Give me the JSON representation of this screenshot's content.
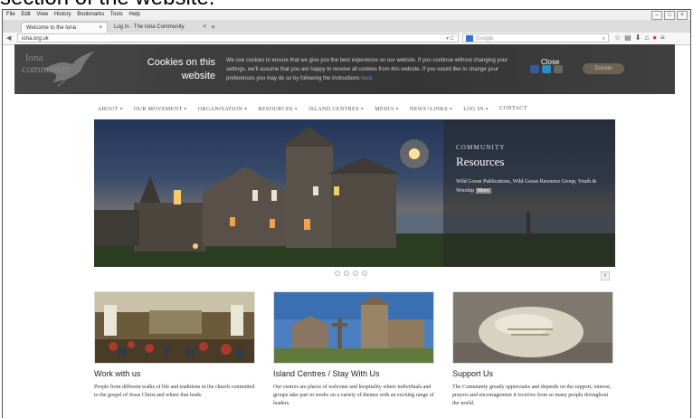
{
  "caption": "section of the website.",
  "browser": {
    "menu": [
      "File",
      "Edit",
      "View",
      "History",
      "Bookmarks",
      "Tools",
      "Help"
    ],
    "tabs": [
      {
        "label": "Welcome to the Iona Commun...",
        "close": "×"
      },
      {
        "label": "Log In · The Iona Community",
        "close": "×"
      }
    ],
    "new_tab": "+",
    "url": "iona.org.uk",
    "search_placeholder": "Google",
    "icons": [
      "back-icon",
      "reload-icon",
      "search-icon",
      "star-icon",
      "bookmarks-icon",
      "download-icon",
      "home-icon",
      "addon-icon",
      "menu-icon"
    ]
  },
  "cookie": {
    "title": "Cookies on this website",
    "text": "We use cookies to ensure that we give you the best experience on our website. If you continue without changing your settings, we'll assume that you are happy to receive all cookies from this website. If you would like to change your preferences you may do so by following the instructions",
    "link": "here.",
    "close": "Close",
    "logo_line1": "Iona",
    "logo_line2": "community",
    "donate": "Donate"
  },
  "nav": [
    "ABOUT",
    "OUR MOVEMENT",
    "ORGANISATION",
    "RESOURCES",
    "ISLAND CENTRES",
    "MEDIA",
    "NEWS+LINKS",
    "LOG IN",
    "CONTACT"
  ],
  "nav_has_dropdown": [
    true,
    true,
    true,
    true,
    true,
    true,
    true,
    true,
    false
  ],
  "hero": {
    "kicker": "COMMUNITY",
    "title": "Resources",
    "text": "Wild Goose Publications, Wild Goose Resource Group, Youth & Worship",
    "more": "More",
    "pause": "II"
  },
  "cards": [
    {
      "title": "Work with us",
      "text": "People from different walks of life and traditions in the church committed to the gospel of Jesus Christ and where that leads."
    },
    {
      "title": "Island Centres / Stay With Us",
      "text": "Our centres are places of welcome and hospitality where individuals and groups take part in weeks on a variety of themes with an exciting range of leaders."
    },
    {
      "title": "Support Us",
      "text": "The Community greatly appreciates and depends on the support, interest, prayers and encouragement it receives from so many people throughout the world."
    }
  ],
  "colors": {
    "cookie_bg": "#3a3a3a",
    "link": "#4aa3e0",
    "hero_sky": "#243658"
  }
}
